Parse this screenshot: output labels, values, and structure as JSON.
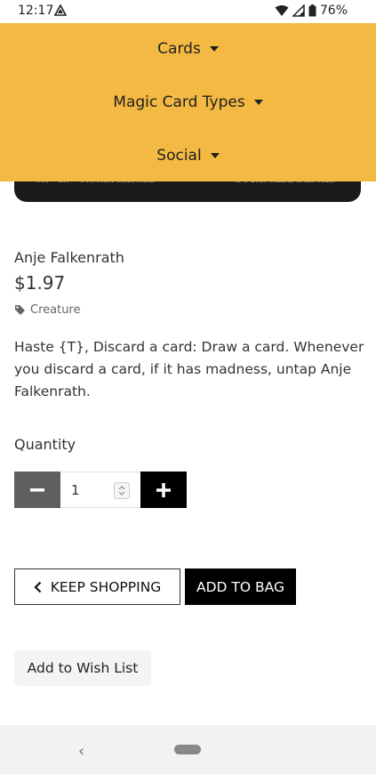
{
  "status": {
    "time": "12:17",
    "battery": "76%"
  },
  "menu": {
    "items": [
      {
        "label": "Cards"
      },
      {
        "label": "Magic Card Types"
      },
      {
        "label": "Social"
      }
    ]
  },
  "card_image": {
    "credit": "C19 • EN ✑ CYNTHIA SHEPPARD",
    "copyright": "™ & © 2019 Wizards of the Coast"
  },
  "product": {
    "name": "Anje Falkenrath",
    "price": "$1.97",
    "category": "Creature",
    "description": "Haste {T}, Discard a card: Draw a card. Whenever you discard a card, if it has madness, untap Anje Falkenrath."
  },
  "quantity": {
    "label": "Quantity",
    "value": "1"
  },
  "actions": {
    "keep_shopping": "KEEP SHOPPING",
    "add_to_bag": "ADD TO BAG",
    "wish_list": "Add to Wish List"
  },
  "nav": {
    "back": "‹"
  }
}
